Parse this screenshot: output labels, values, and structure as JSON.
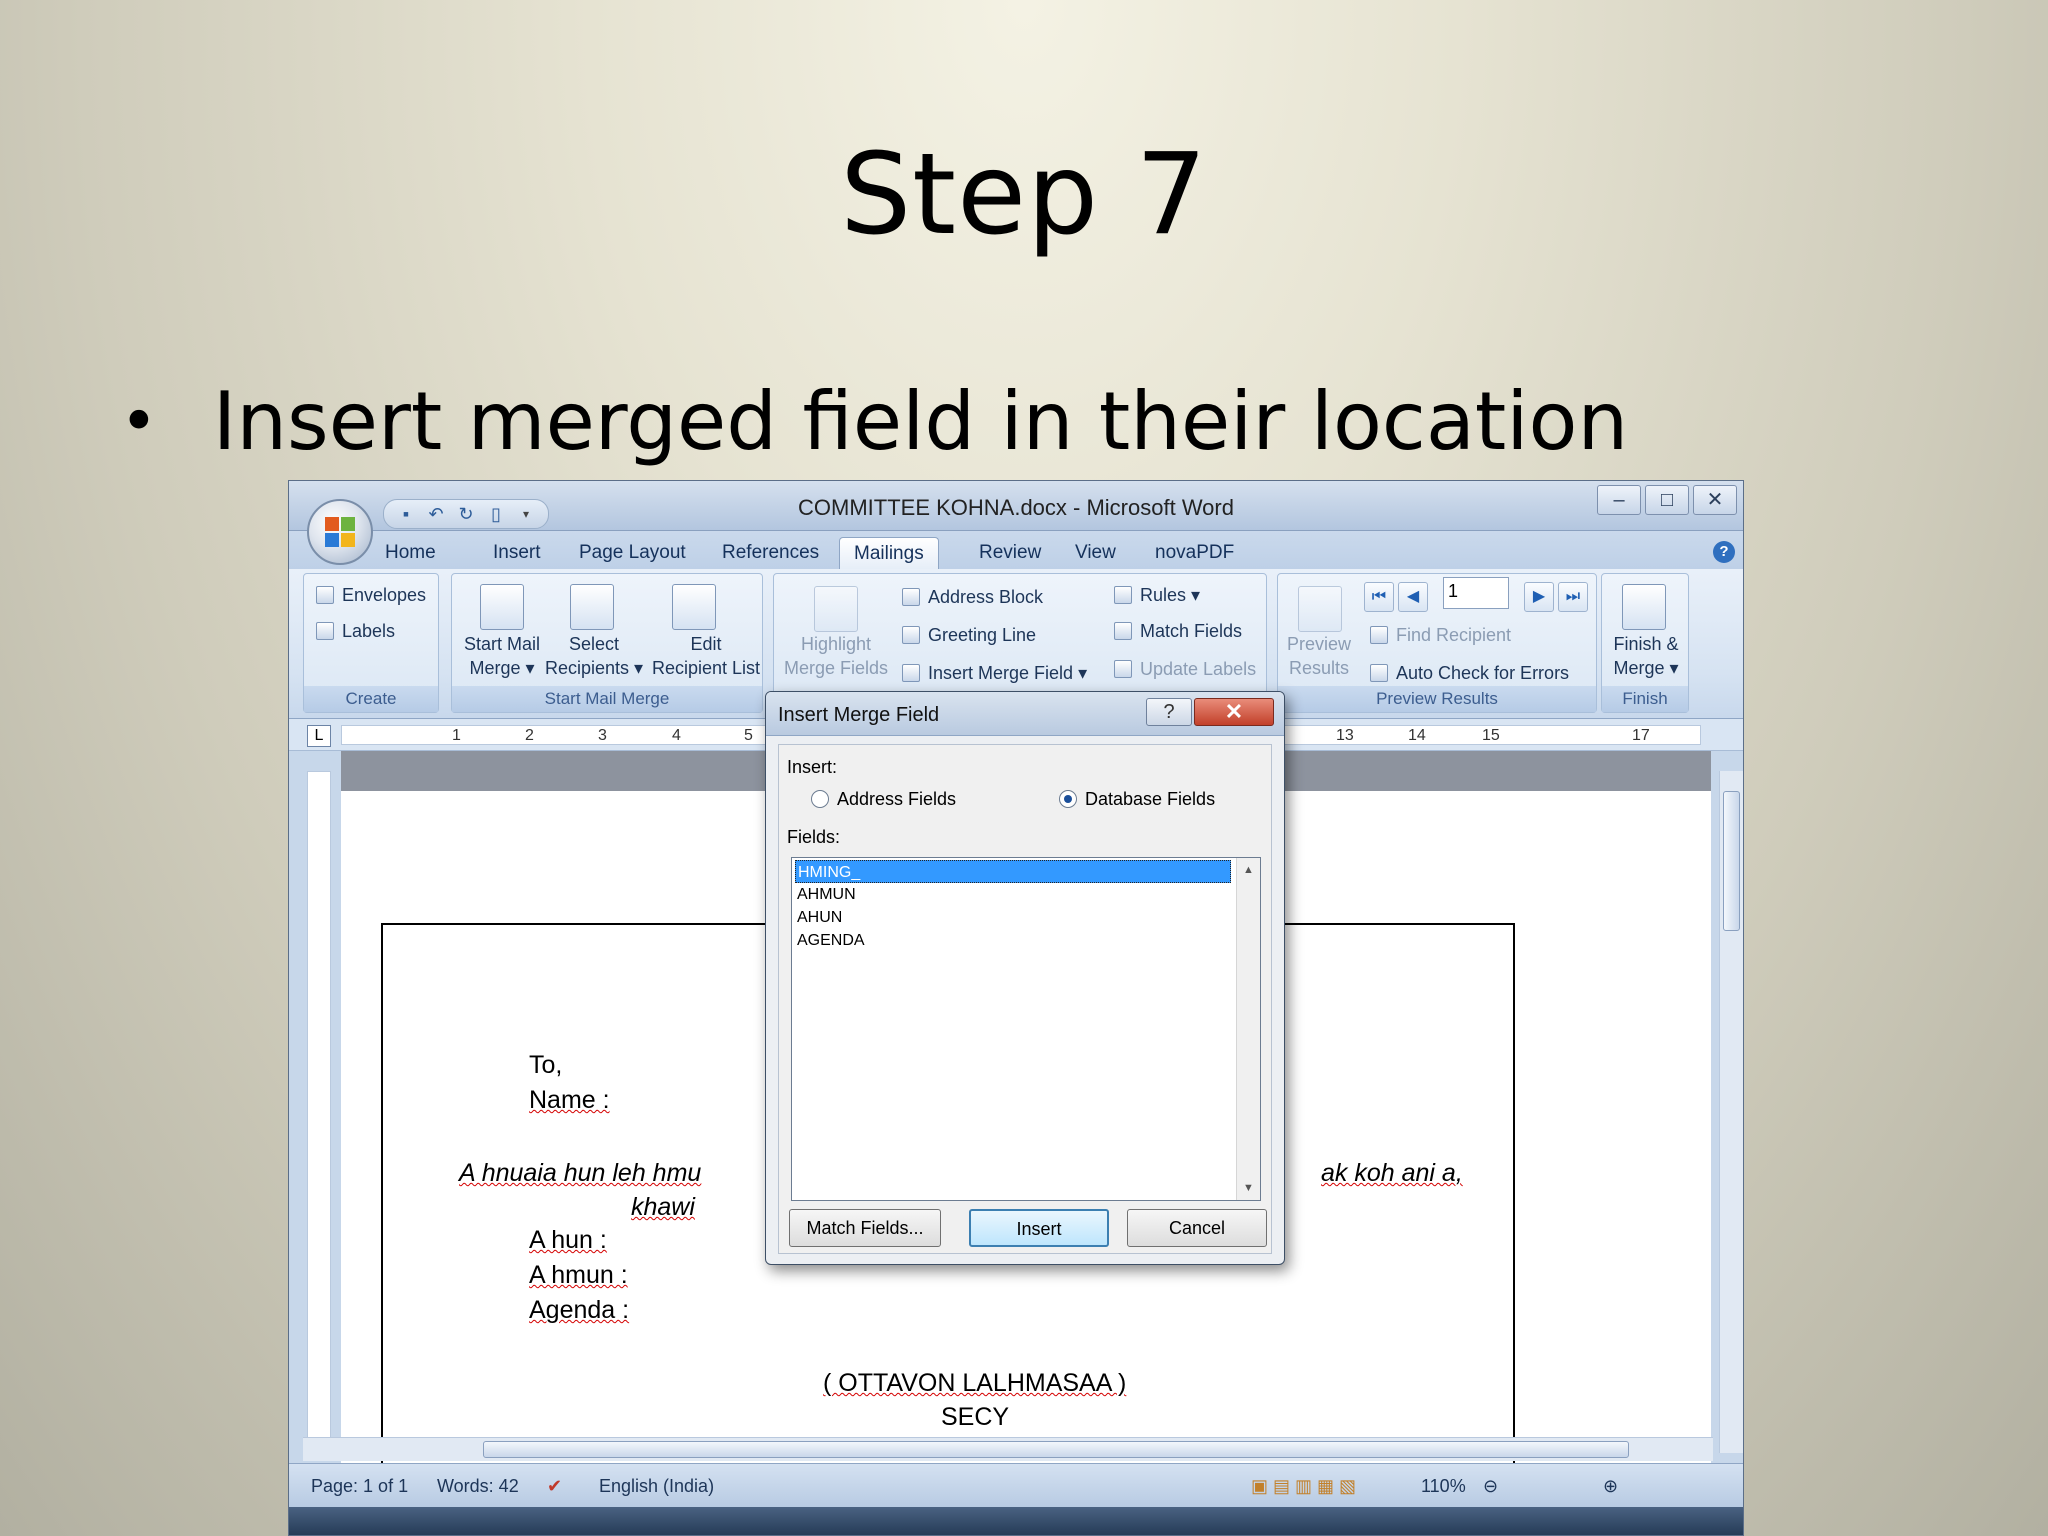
{
  "slide": {
    "title": "Step 7",
    "bullet": "Insert merged field in their location"
  },
  "window": {
    "title": "COMMITTEE KOHNA.docx - Microsoft Word",
    "tabs": [
      "Home",
      "Insert",
      "Page Layout",
      "References",
      "Mailings",
      "Review",
      "View",
      "novaPDF"
    ],
    "active_tab": "Mailings"
  },
  "ribbon": {
    "create": {
      "label": "Create",
      "envelopes": "Envelopes",
      "labels": "Labels"
    },
    "start_mail_merge": {
      "label": "Start Mail Merge",
      "start_l1": "Start Mail",
      "start_l2": "Merge",
      "select_l1": "Select",
      "select_l2": "Recipients",
      "edit_l1": "Edit",
      "edit_l2": "Recipient List"
    },
    "write_insert": {
      "highlight_l1": "Highlight",
      "highlight_l2": "Merge Fields",
      "address_block": "Address Block",
      "greeting_line": "Greeting Line",
      "insert_merge_field": "Insert Merge Field",
      "rules": "Rules",
      "match_fields": "Match Fields",
      "update_labels": "Update Labels"
    },
    "preview": {
      "label": "Preview Results",
      "preview_l1": "Preview",
      "preview_l2": "Results",
      "record": "1",
      "find_recipient": "Find Recipient",
      "auto_check": "Auto Check for Errors"
    },
    "finish": {
      "label": "Finish",
      "finish_l1": "Finish &",
      "finish_l2": "Merge"
    }
  },
  "ruler": {
    "ticks_left": [
      "1",
      "2",
      "3",
      "4",
      "5"
    ],
    "ticks_right": [
      "13",
      "14",
      "15",
      "17"
    ]
  },
  "document": {
    "to": "To,",
    "name": "Name  :",
    "para_left": "A hnuaia hun leh hmu",
    "para_right": "ak koh ani a,",
    "para_line2": "khawi",
    "ahun": "A hun :",
    "ahmun": "A hmun :",
    "agenda": "Agenda :",
    "signature": "( OTTAVON LALHMASAA )",
    "secy": "SECY"
  },
  "status": {
    "page": "Page: 1 of 1",
    "words": "Words: 42",
    "language": "English (India)",
    "zoom": "110%"
  },
  "dialog": {
    "title": "Insert Merge Field",
    "insert_label": "Insert:",
    "address_fields": "Address Fields",
    "database_fields": "Database Fields",
    "selected_option": "Database Fields",
    "fields_label": "Fields:",
    "fields": [
      "HMING_",
      "AHMUN",
      "AHUN",
      "AGENDA"
    ],
    "selected_field": "HMING_",
    "match_fields_btn": "Match Fields...",
    "insert_btn": "Insert",
    "cancel_btn": "Cancel"
  }
}
